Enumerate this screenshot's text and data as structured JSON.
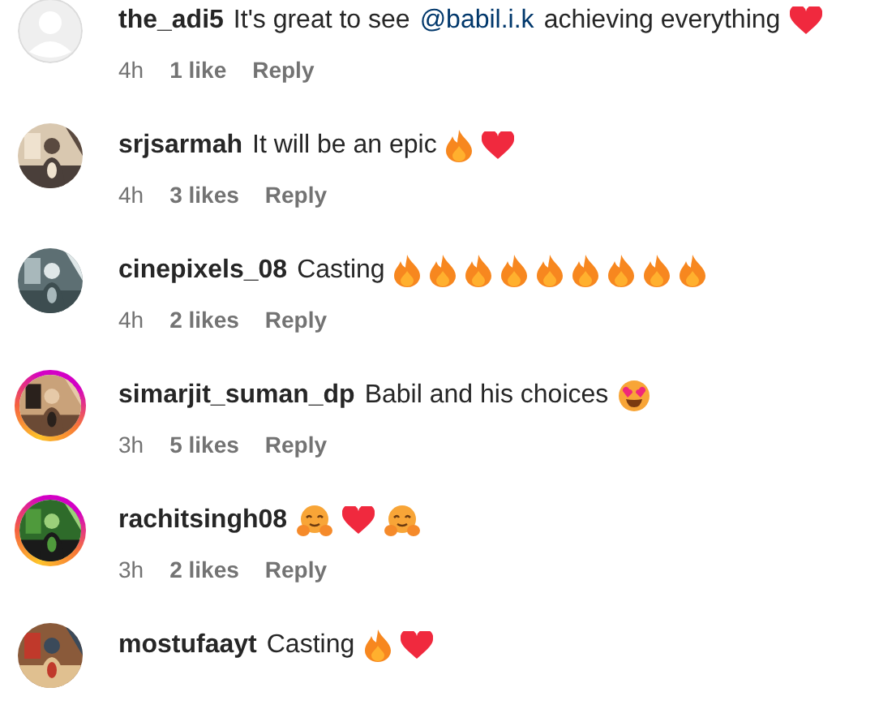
{
  "comments": [
    {
      "avatar": {
        "kind": "blank",
        "story_ring": false
      },
      "username": "the_adi5",
      "body": [
        {
          "kind": "text",
          "text": "It's great to see"
        },
        {
          "kind": "mention",
          "text": "@babil.i.k"
        },
        {
          "kind": "text",
          "text": "achieving everything"
        },
        {
          "kind": "heart"
        }
      ],
      "meta": {
        "time": "4h",
        "likes": "1 like",
        "reply": "Reply"
      }
    },
    {
      "avatar": {
        "kind": "picture",
        "story_ring": false
      },
      "username": "srjsarmah",
      "body": [
        {
          "kind": "text",
          "text": "It will be an epic"
        },
        {
          "kind": "fire"
        },
        {
          "kind": "heart"
        }
      ],
      "meta": {
        "time": "4h",
        "likes": "3 likes",
        "reply": "Reply"
      }
    },
    {
      "avatar": {
        "kind": "picture",
        "story_ring": false
      },
      "username": "cinepixels_08",
      "body": [
        {
          "kind": "text",
          "text": "Casting"
        },
        {
          "kind": "fire"
        },
        {
          "kind": "fire"
        },
        {
          "kind": "fire"
        },
        {
          "kind": "fire"
        },
        {
          "kind": "fire"
        },
        {
          "kind": "fire"
        },
        {
          "kind": "fire"
        },
        {
          "kind": "fire"
        },
        {
          "kind": "fire"
        }
      ],
      "meta": {
        "time": "4h",
        "likes": "2 likes",
        "reply": "Reply"
      }
    },
    {
      "avatar": {
        "kind": "picture",
        "story_ring": true
      },
      "username": "simarjit_suman_dp",
      "body": [
        {
          "kind": "text",
          "text": "Babil and his choices"
        },
        {
          "kind": "heart_eyes"
        }
      ],
      "meta": {
        "time": "3h",
        "likes": "5 likes",
        "reply": "Reply"
      }
    },
    {
      "avatar": {
        "kind": "picture",
        "story_ring": true
      },
      "username": "rachitsingh08",
      "body": [
        {
          "kind": "hug"
        },
        {
          "kind": "heart"
        },
        {
          "kind": "hug"
        }
      ],
      "meta": {
        "time": "3h",
        "likes": "2 likes",
        "reply": "Reply"
      }
    },
    {
      "avatar": {
        "kind": "picture",
        "story_ring": false
      },
      "username": "mostufaayt",
      "body": [
        {
          "kind": "text",
          "text": "Casting"
        },
        {
          "kind": "fire"
        },
        {
          "kind": "heart"
        }
      ]
    }
  ]
}
